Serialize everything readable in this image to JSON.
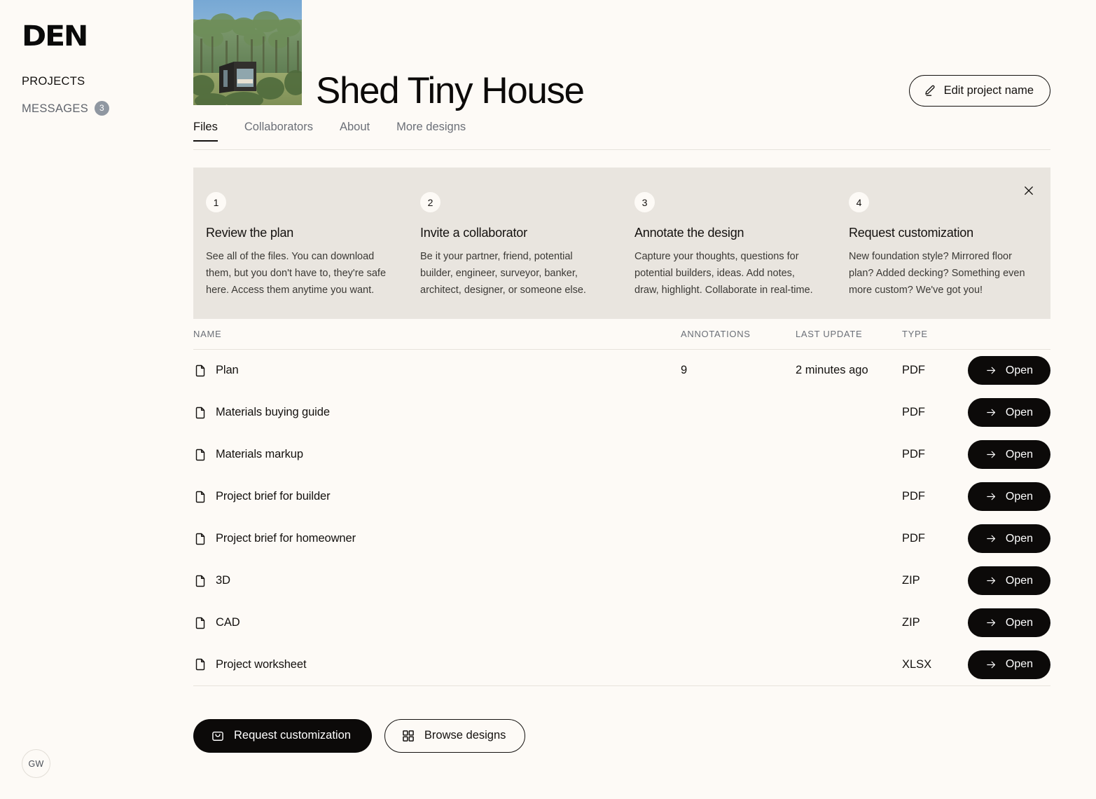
{
  "brand": {
    "logo": "DEN"
  },
  "sidebar": {
    "items": [
      {
        "label": "PROJECTS",
        "active": true,
        "badge": null
      },
      {
        "label": "MESSAGES",
        "active": false,
        "badge": "3"
      }
    ],
    "avatar_initials": "GW"
  },
  "header": {
    "project_title": "Shed Tiny House",
    "edit_button_label": "Edit project name",
    "edit_icon": "pencil-icon",
    "thumbnail_alt": "tiny house cabin in forest"
  },
  "tabs": [
    {
      "label": "Files",
      "active": true
    },
    {
      "label": "Collaborators",
      "active": false
    },
    {
      "label": "About",
      "active": false
    },
    {
      "label": "More designs",
      "active": false
    }
  ],
  "steps_panel": {
    "close_icon": "close-icon",
    "steps": [
      {
        "number": "1",
        "title": "Review the plan",
        "body": "See all of the files. You can download them, but you don't have to, they're safe here. Access them anytime you want."
      },
      {
        "number": "2",
        "title": "Invite a collaborator",
        "body": "Be it your partner, friend, potential builder, engineer, surveyor, banker, architect, designer, or someone else."
      },
      {
        "number": "3",
        "title": "Annotate the design",
        "body": "Capture your thoughts, questions for potential builders, ideas. Add notes, draw, highlight. Collaborate in real-time."
      },
      {
        "number": "4",
        "title": "Request customization",
        "body": "New foundation style? Mirrored floor plan? Added decking? Something even more custom? We've got you!"
      }
    ]
  },
  "files_table": {
    "columns": [
      "NAME",
      "ANNOTATIONS",
      "LAST UPDATE",
      "TYPE"
    ],
    "open_label": "Open",
    "open_icon": "arrow-right-icon",
    "file_icon": "file-document-icon",
    "rows": [
      {
        "name": "Plan",
        "annotations": "9",
        "last_update": "2 minutes ago",
        "type": "PDF"
      },
      {
        "name": "Materials buying guide",
        "annotations": "",
        "last_update": "",
        "type": "PDF"
      },
      {
        "name": "Materials markup",
        "annotations": "",
        "last_update": "",
        "type": "PDF"
      },
      {
        "name": "Project brief for builder",
        "annotations": "",
        "last_update": "",
        "type": "PDF"
      },
      {
        "name": "Project brief for homeowner",
        "annotations": "",
        "last_update": "",
        "type": "PDF"
      },
      {
        "name": "3D",
        "annotations": "",
        "last_update": "",
        "type": "ZIP"
      },
      {
        "name": "CAD",
        "annotations": "",
        "last_update": "",
        "type": "ZIP"
      },
      {
        "name": "Project worksheet",
        "annotations": "",
        "last_update": "",
        "type": "XLSX"
      }
    ]
  },
  "footer_actions": {
    "request_label": "Request customization",
    "request_icon": "shopping-bag-icon",
    "browse_label": "Browse designs",
    "browse_icon": "grid-icon"
  },
  "colors": {
    "page_background": "#fdfaf6",
    "panel_background": "#e9e5df",
    "ink": "#14110f",
    "muted": "#6b6f77",
    "badge": "#8f97a1",
    "divider": "#e7e3dc"
  }
}
